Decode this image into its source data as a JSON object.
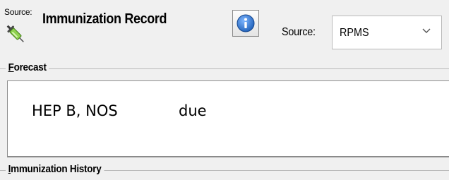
{
  "header": {
    "source_tag": "Source:",
    "title": "Immunization Record",
    "app_icon": "syringe-icon",
    "info_icon": "info-icon",
    "source_label": "Source:",
    "source_value": "RPMS",
    "dropdown_icon": "chevron-down-icon"
  },
  "forecast": {
    "label_accel": "F",
    "label_rest": "orecast",
    "items": [
      {
        "vaccine": "HEP B, NOS",
        "status": "due"
      }
    ]
  },
  "history": {
    "label_accel": "I",
    "label_rest": "mmunization History"
  },
  "colors": {
    "background": "#f0f0f0",
    "panel": "#ffffff",
    "border": "#b9b9b9",
    "info_blue": "#1d5fb8"
  }
}
